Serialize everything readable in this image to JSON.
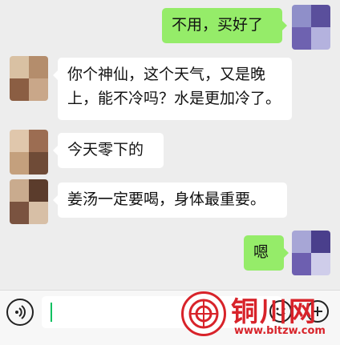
{
  "messages": [
    {
      "side": "out",
      "text": "不用，买好了"
    },
    {
      "side": "in",
      "lines": [
        "你个神仙，这个天气，又是晚",
        "上，能不冷吗？水是更加冷了。"
      ]
    },
    {
      "side": "in",
      "text": "今天零下的"
    },
    {
      "side": "in",
      "text": "姜汤一定要喝，身体最重要。"
    },
    {
      "side": "out",
      "text": "嗯"
    }
  ],
  "input": {
    "value": ""
  },
  "icons": {
    "voice": "voice-icon",
    "emoji": "emoji-icon",
    "plus": "plus-icon"
  },
  "watermark": {
    "title": "铜川网",
    "url": "www.bltzw.com"
  },
  "colors": {
    "background": "#ededed",
    "out_bubble": "#95ec69",
    "in_bubble": "#ffffff",
    "watermark": "#d8232a"
  }
}
